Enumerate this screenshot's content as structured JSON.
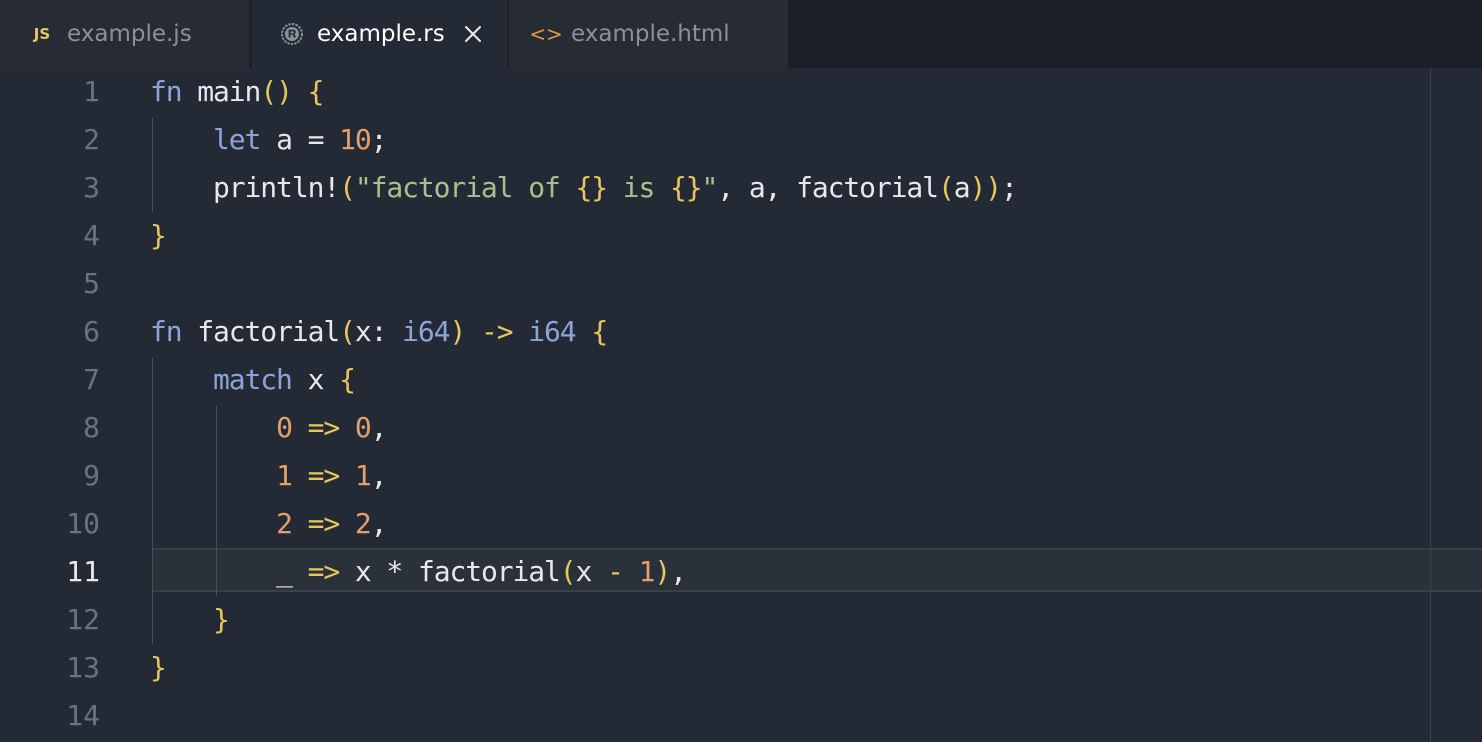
{
  "tabs": [
    {
      "label": "example.js",
      "icon": "js-file-icon",
      "icon_text": "JS",
      "active": false
    },
    {
      "label": "example.rs",
      "icon": "rust-file-icon",
      "active": true
    },
    {
      "label": "example.html",
      "icon": "html-file-icon",
      "icon_text": "<>",
      "active": false
    }
  ],
  "editor": {
    "current_line": 11,
    "lines": [
      {
        "n": "1",
        "text": "fn main() {"
      },
      {
        "n": "2",
        "text": "    let a = 10;"
      },
      {
        "n": "3",
        "text": "    println!(\"factorial of {} is {}\", a, factorial(a));"
      },
      {
        "n": "4",
        "text": "}"
      },
      {
        "n": "5",
        "text": ""
      },
      {
        "n": "6",
        "text": "fn factorial(x: i64) -> i64 {"
      },
      {
        "n": "7",
        "text": "    match x {"
      },
      {
        "n": "8",
        "text": "        0 => 0,"
      },
      {
        "n": "9",
        "text": "        1 => 1,"
      },
      {
        "n": "10",
        "text": "        2 => 2,"
      },
      {
        "n": "11",
        "text": "        _ => x * factorial(x - 1),"
      },
      {
        "n": "12",
        "text": "    }"
      },
      {
        "n": "13",
        "text": "}"
      },
      {
        "n": "14",
        "text": ""
      }
    ]
  },
  "colors": {
    "background": "#232a35",
    "tabbar": "#1c1f25",
    "keyword": "#8da4d8",
    "number": "#e3a06a",
    "string": "#a7c08e",
    "bracket": "#e7c65e"
  }
}
